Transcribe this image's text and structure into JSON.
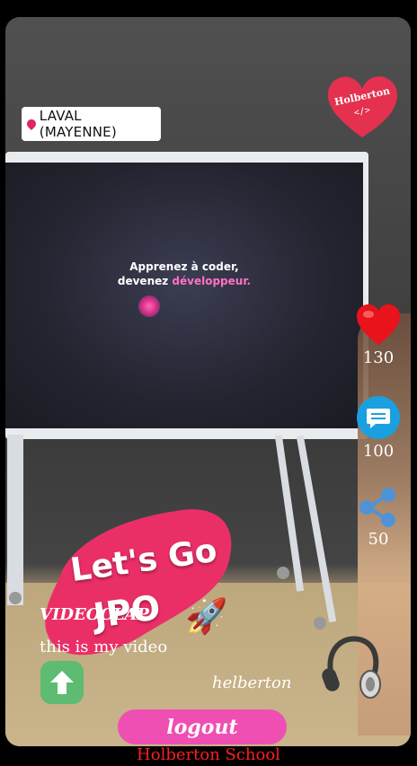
{
  "video": {
    "location_tag": "LAVAL (MAYENNE)",
    "logo_text": "Holberton",
    "logo_sub": "</>",
    "sticker_line1": "Let's Go",
    "sticker_line2": "JPO",
    "screen_title_line1": "Apprenez à coder,",
    "screen_title_line2_a": "devenez ",
    "screen_title_line2_b": "développeur."
  },
  "actions": {
    "likes": "130",
    "comments": "100",
    "shares": "50"
  },
  "post": {
    "title": "VIDEOCLAP",
    "description": "this is my video",
    "author": "helberton"
  },
  "buttons": {
    "logout_label": "logout"
  },
  "footer": {
    "text": "Holberton School"
  },
  "colors": {
    "accent": "#ef4fb2",
    "like": "#e8131b",
    "comment": "#1aa0e0",
    "share": "#4f93d6",
    "up_button": "#5dbb72",
    "footer_text": "#ff1e1e"
  },
  "icons": [
    "heart-icon",
    "comment-icon",
    "share-icon",
    "arrow-up-icon",
    "headphones-icon",
    "location-pin-icon"
  ]
}
